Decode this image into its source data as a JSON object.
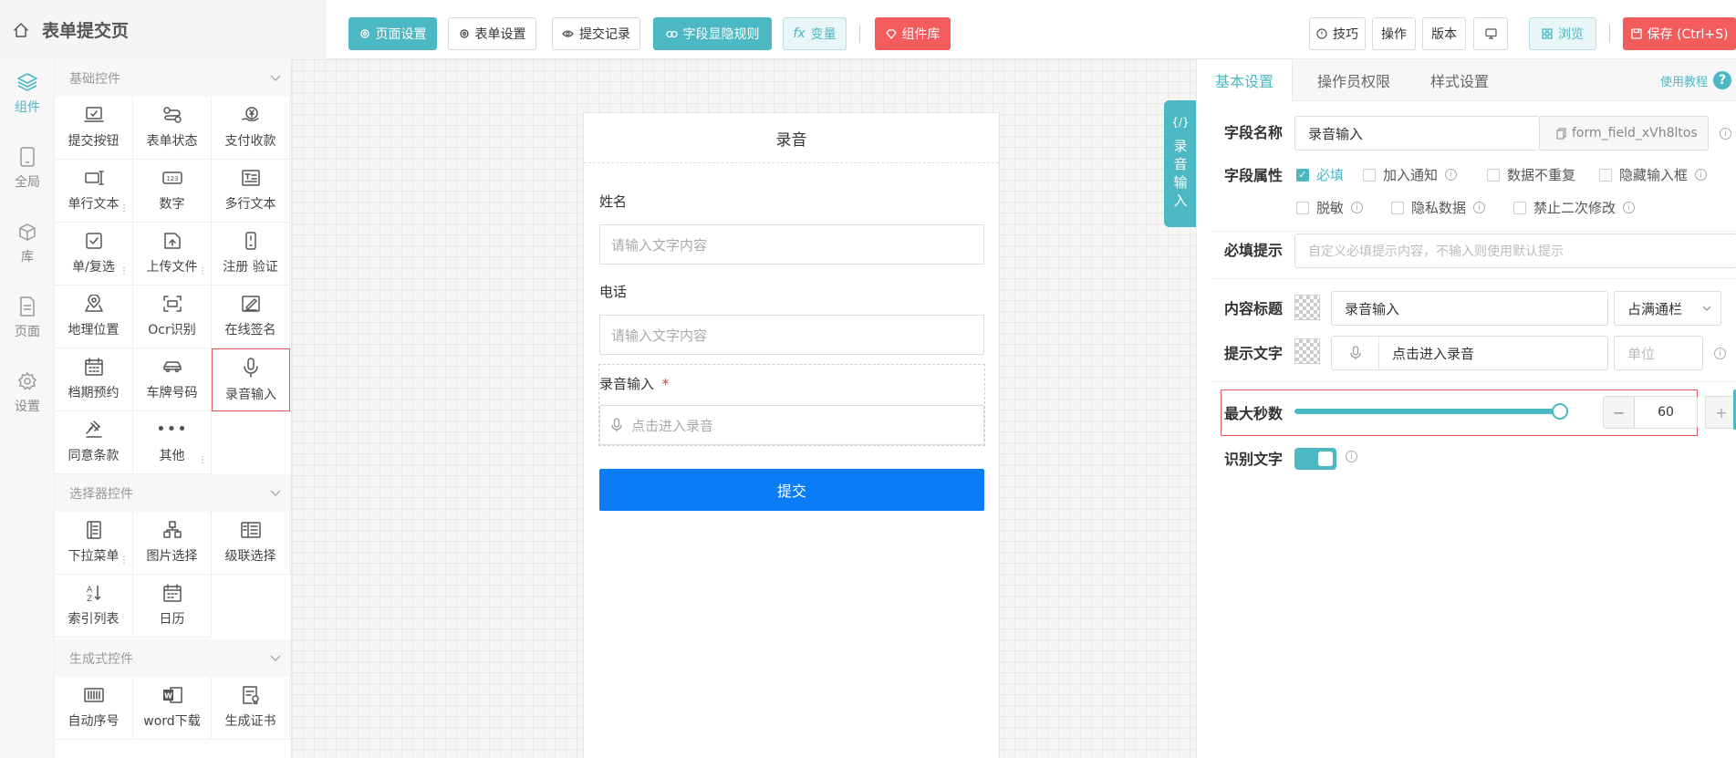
{
  "header": {
    "title": "表单提交页"
  },
  "toolbar": {
    "page_settings": "页面设置",
    "form_settings": "表单设置",
    "submit_records": "提交记录",
    "field_rules": "字段显隐规则",
    "variables": "变量",
    "variables_prefix": "fx",
    "component_lib": "组件库",
    "tips": "技巧",
    "operations": "操作",
    "version": "版本",
    "browse": "浏览",
    "save": "保存 (Ctrl+S)"
  },
  "nav": [
    {
      "label": "组件",
      "icon": "layers-icon"
    },
    {
      "label": "全局",
      "icon": "tablet-icon"
    },
    {
      "label": "库",
      "icon": "box-icon"
    },
    {
      "label": "页面",
      "icon": "file-icon"
    },
    {
      "label": "设置",
      "icon": "gear-icon"
    }
  ],
  "palette": {
    "sections": [
      "基础控件",
      "选择器控件",
      "生成式控件"
    ],
    "basic": [
      {
        "label": "提交按钮",
        "icon": "laptop-icon"
      },
      {
        "label": "表单状态",
        "icon": "flow-icon"
      },
      {
        "label": "支付收款",
        "icon": "yen-icon"
      },
      {
        "label": "单行文本",
        "icon": "text-line-icon"
      },
      {
        "label": "数字",
        "icon": "number-icon"
      },
      {
        "label": "多行文本",
        "icon": "multiline-icon"
      },
      {
        "label": "单/复选",
        "icon": "checkbox-icon"
      },
      {
        "label": "上传文件",
        "icon": "upload-icon"
      },
      {
        "label": "注册 验证",
        "icon": "phone-icon"
      },
      {
        "label": "地理位置",
        "icon": "location-icon"
      },
      {
        "label": "Ocr识别",
        "icon": "scan-icon"
      },
      {
        "label": "在线签名",
        "icon": "sign-icon"
      },
      {
        "label": "档期预约",
        "icon": "calendar-icon"
      },
      {
        "label": "车牌号码",
        "icon": "car-icon"
      },
      {
        "label": "录音输入",
        "icon": "mic-icon"
      },
      {
        "label": "同意条款",
        "icon": "gavel-icon"
      },
      {
        "label": "其他",
        "icon": "more-icon"
      }
    ],
    "selector": [
      {
        "label": "下拉菜单",
        "icon": "list-icon"
      },
      {
        "label": "图片选择",
        "icon": "image-grid-icon"
      },
      {
        "label": "级联选择",
        "icon": "cascade-icon"
      },
      {
        "label": "索引列表",
        "icon": "sort-az-icon"
      },
      {
        "label": "日历",
        "icon": "calendar-icon"
      }
    ],
    "generative": [
      {
        "label": "自动序号",
        "icon": "barcode-icon"
      },
      {
        "label": "word下载",
        "icon": "word-icon"
      },
      {
        "label": "生成证书",
        "icon": "certificate-icon"
      }
    ]
  },
  "form": {
    "title": "录音",
    "fields": [
      {
        "label": "姓名",
        "placeholder": "请输入文字内容"
      },
      {
        "label": "电话",
        "placeholder": "请输入文字内容"
      }
    ],
    "recorder": {
      "label": "录音输入",
      "required_mark": "*",
      "placeholder": "点击进入录音"
    },
    "submit": "提交",
    "side_tab_code": "{/}",
    "side_tab_text": "录音输入"
  },
  "props": {
    "tabs": [
      "基本设置",
      "操作员权限",
      "样式设置"
    ],
    "help": "使用教程",
    "field_name_label": "字段名称",
    "field_name_value": "录音输入",
    "field_id": "form_field_xVh8ltos",
    "field_attr_label": "字段属性",
    "attrs": [
      {
        "label": "必填",
        "checked": true
      },
      {
        "label": "加入通知",
        "checked": false
      },
      {
        "label": "数据不重复",
        "checked": false
      },
      {
        "label": "隐藏输入框",
        "checked": false
      },
      {
        "label": "脱敏",
        "checked": false
      },
      {
        "label": "隐私数据",
        "checked": false
      },
      {
        "label": "禁止二次修改",
        "checked": false
      }
    ],
    "required_hint_label": "必填提示",
    "required_hint_placeholder": "自定义必填提示内容，不输入则使用默认提示",
    "content_title_label": "内容标题",
    "content_title_value": "录音输入",
    "width_select": "占满通栏",
    "hint_text_label": "提示文字",
    "hint_text_value": "点击进入录音",
    "unit_placeholder": "单位",
    "max_seconds_label": "最大秒数",
    "max_seconds_value": "60",
    "max_seconds_fraction": 1.0,
    "recognize_label": "识别文字",
    "recognize_on": true,
    "accent": "#4cb8c4",
    "danger": "#f35c5c",
    "submit_blue": "#0a7cf6"
  }
}
